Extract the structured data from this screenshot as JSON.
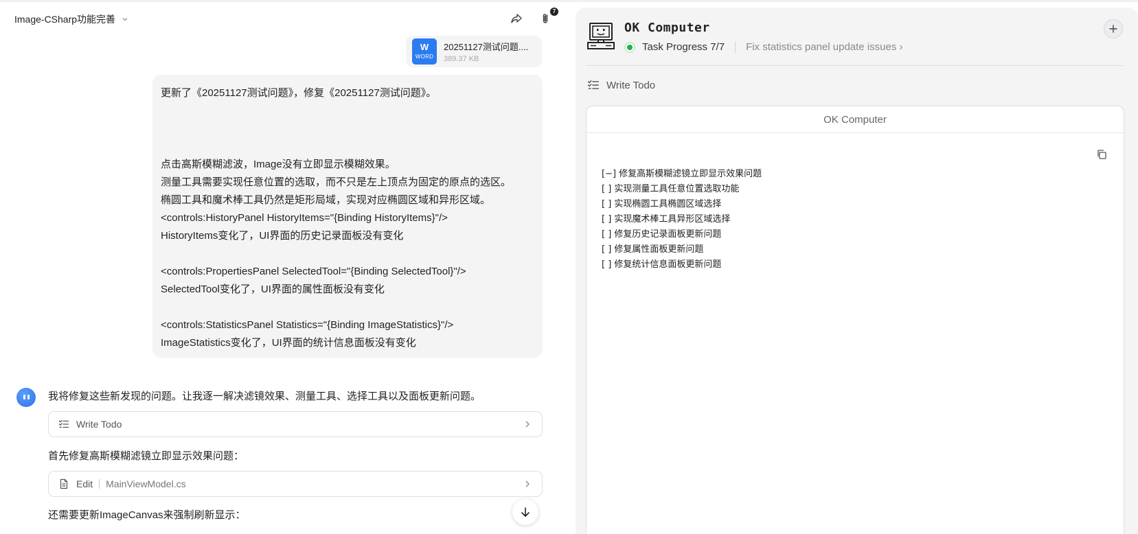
{
  "conversation": {
    "title": "Image-CSharp功能完善",
    "attachment_count": "7"
  },
  "attachment": {
    "type_label": "WORD",
    "type_letter": "W",
    "name": "20251127测试问题....",
    "size": "389.37 KB"
  },
  "user_message": {
    "lines": [
      "更新了《20251127测试问题》，修复《20251127测试问题》。",
      "",
      "",
      "",
      "点击高斯模糊滤波，Image没有立即显示模糊效果。",
      "测量工具需要实现任意位置的选取，而不只是左上顶点为固定的原点的选区。",
      "椭圆工具和魔术棒工具仍然是矩形局域，实现对应椭圆区域和异形区域。",
      "<controls:HistoryPanel HistoryItems=\"{Binding HistoryItems}\"/>",
      "HistoryItems变化了，UI界面的历史记录面板没有变化",
      "",
      "<controls:PropertiesPanel SelectedTool=\"{Binding SelectedTool}\"/>",
      "SelectedTool变化了，UI界面的属性面板没有变化",
      "",
      "<controls:StatisticsPanel Statistics=\"{Binding ImageStatistics}\"/>",
      "ImageStatistics变化了，UI界面的统计信息面板没有变化"
    ]
  },
  "assistant": {
    "intro": "我将修复这些新发现的问题。让我逐一解决滤镜效果、测量工具、选择工具以及面板更新问题。",
    "tool_write_todo": "Write Todo",
    "step1": "首先修复高斯模糊滤镜立即显示效果问题：",
    "tool_edit_label": "Edit",
    "tool_edit_file": "MainViewModel.cs",
    "step2": "还需要更新ImageCanvas来强制刷新显示："
  },
  "computer_panel": {
    "title": "OK Computer",
    "progress": "Task Progress 7/7",
    "current_task": "Fix statistics panel update issues",
    "current_task_chevron": "›",
    "section_label": "Write Todo",
    "doc_title": "OK Computer",
    "todos": [
      "[−] 修复高斯模糊滤镜立即显示效果问题",
      "[ ] 实现测量工具任意位置选取功能",
      "[ ] 实现椭圆工具椭圆区域选择",
      "[ ] 实现魔术棒工具异形区域选择",
      "[ ] 修复历史记录面板更新问题",
      "[ ] 修复属性面板更新问题",
      "[ ] 修复统计信息面板更新问题"
    ],
    "status_color": "#22b14c"
  },
  "icons": {
    "share": "share-icon",
    "attachment": "paperclip-icon",
    "scroll": "arrow-down-icon",
    "copy": "copy-icon",
    "new": "plus-icon",
    "computer": "computer-icon"
  }
}
